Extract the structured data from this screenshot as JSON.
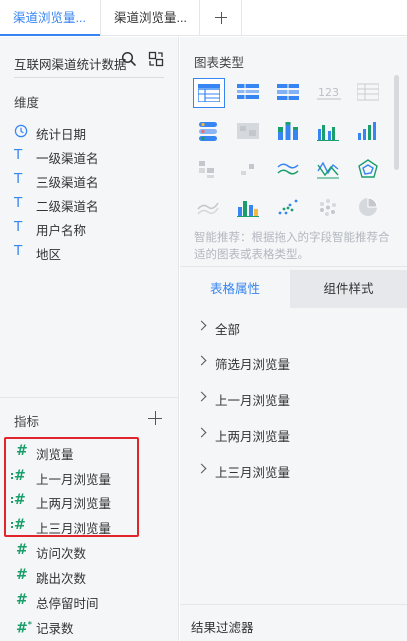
{
  "tabs": [
    {
      "label": "渠道浏览量...",
      "active": true
    },
    {
      "label": "渠道浏览量...",
      "active": false
    }
  ],
  "datasource": {
    "name": "互联网渠道统计数据"
  },
  "dimensions": {
    "title": "维度",
    "fields": [
      {
        "type": "date",
        "label": "统计日期"
      },
      {
        "type": "text",
        "label": "一级渠道名"
      },
      {
        "type": "text",
        "label": "三级渠道名"
      },
      {
        "type": "text",
        "label": "二级渠道名"
      },
      {
        "type": "text",
        "label": "用户名称"
      },
      {
        "type": "text",
        "label": "地区"
      }
    ]
  },
  "metrics": {
    "title": "指标",
    "fields": [
      {
        "type": "number",
        "label": "浏览量"
      },
      {
        "type": "calculated",
        "label": "上一月浏览量"
      },
      {
        "type": "calculated",
        "label": "上两月浏览量"
      },
      {
        "type": "calculated",
        "label": "上三月浏览量"
      },
      {
        "type": "number",
        "label": "访问次数"
      },
      {
        "type": "number",
        "label": "跳出次数"
      },
      {
        "type": "number",
        "label": "总停留时间"
      },
      {
        "type": "count",
        "label": "记录数"
      }
    ]
  },
  "chart_panel": {
    "title": "图表类型",
    "selected": "table",
    "types": [
      "table",
      "cross-table",
      "detail-table",
      "kpi-card",
      "text-table",
      "filter-table",
      "heat-table",
      "stacked-bar",
      "column",
      "column-desc",
      "treemap",
      "scatter-small",
      "line",
      "radar-line",
      "radar",
      "area",
      "combo",
      "dot",
      "bubble",
      "pie"
    ],
    "hint": "智能推荐：根据拖入的字段智能推荐合适的图表或表格类型。"
  },
  "prop_tabs": {
    "table_props": "表格属性",
    "component_style": "组件样式"
  },
  "props": [
    "全部",
    "筛选月浏览量",
    "上一月浏览量",
    "上两月浏览量",
    "上三月浏览量"
  ],
  "result_filter": "结果过滤器",
  "colors": {
    "accent": "#3685f2",
    "measure": "#1a9e6a",
    "highlight": "#e2242c"
  }
}
